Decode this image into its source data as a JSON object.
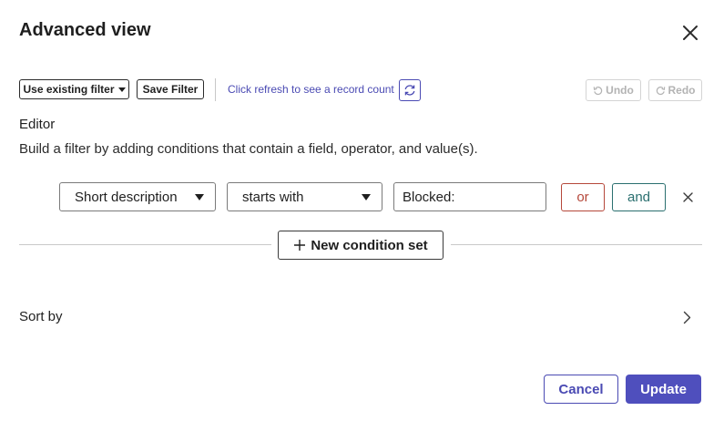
{
  "dialog": {
    "title": "Advanced view"
  },
  "toolbar": {
    "use_existing_filter_label": "Use existing filter",
    "save_filter_label": "Save Filter",
    "refresh_hint": "Click refresh to see a record count",
    "undo_label": "Undo",
    "redo_label": "Redo"
  },
  "editor": {
    "label": "Editor",
    "help_text": "Build a filter by adding conditions that contain a field, operator, and value(s).",
    "condition": {
      "field": "Short description",
      "operator": "starts with",
      "value": "Blocked:",
      "or_label": "or",
      "and_label": "and"
    },
    "new_condition_set_label": "New condition set"
  },
  "sort": {
    "label": "Sort by"
  },
  "footer": {
    "cancel_label": "Cancel",
    "update_label": "Update"
  },
  "icons": {
    "close": "close-icon",
    "refresh": "refresh-icon",
    "undo": "undo-icon",
    "redo": "redo-icon",
    "remove": "remove-condition-icon",
    "plus": "plus-icon",
    "chevron": "chevron-right-icon"
  },
  "colors": {
    "accent": "#4f4fbd",
    "link": "#4a4ab3",
    "or": "#b5473a",
    "and": "#2a6f6f",
    "disabled": "#b3b3b3"
  }
}
